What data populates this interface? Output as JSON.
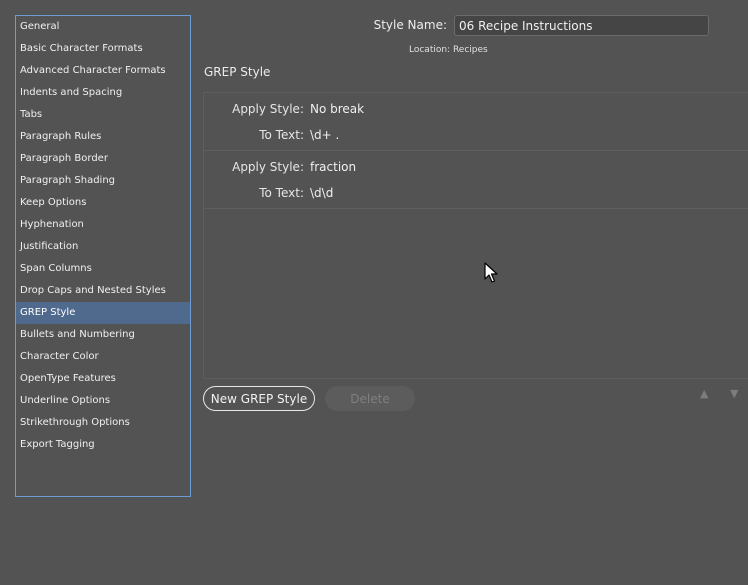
{
  "sidebar": {
    "items": [
      {
        "label": "General"
      },
      {
        "label": "Basic Character Formats"
      },
      {
        "label": "Advanced Character Formats"
      },
      {
        "label": "Indents and Spacing"
      },
      {
        "label": "Tabs"
      },
      {
        "label": "Paragraph Rules"
      },
      {
        "label": "Paragraph Border"
      },
      {
        "label": "Paragraph Shading"
      },
      {
        "label": "Keep Options"
      },
      {
        "label": "Hyphenation"
      },
      {
        "label": "Justification"
      },
      {
        "label": "Span Columns"
      },
      {
        "label": "Drop Caps and Nested Styles"
      },
      {
        "label": "GREP Style"
      },
      {
        "label": "Bullets and Numbering"
      },
      {
        "label": "Character Color"
      },
      {
        "label": "OpenType Features"
      },
      {
        "label": "Underline Options"
      },
      {
        "label": "Strikethrough Options"
      },
      {
        "label": "Export Tagging"
      }
    ],
    "selected": "GREP Style"
  },
  "header": {
    "style_name_label": "Style Name:",
    "style_name_value": "06 Recipe Instructions",
    "location": "Location: Recipes"
  },
  "section": {
    "title": "GREP Style"
  },
  "grep_styles": [
    {
      "apply_label": "Apply Style:",
      "apply_value": "No break",
      "text_label": "To Text:",
      "text_value": "\\d+ ."
    },
    {
      "apply_label": "Apply Style:",
      "apply_value": "fraction",
      "text_label": "To Text:",
      "text_value": "\\d\\d"
    }
  ],
  "buttons": {
    "new_label": "New GREP Style",
    "delete_label": "Delete"
  },
  "icons": {
    "move_up": "triangle-up-icon",
    "move_down": "triangle-down-icon",
    "cursor": "mouse-pointer-icon"
  },
  "colors": {
    "background": "#535353",
    "selection": "#4f6a8d",
    "sidebar_border": "#6d9bd3"
  }
}
